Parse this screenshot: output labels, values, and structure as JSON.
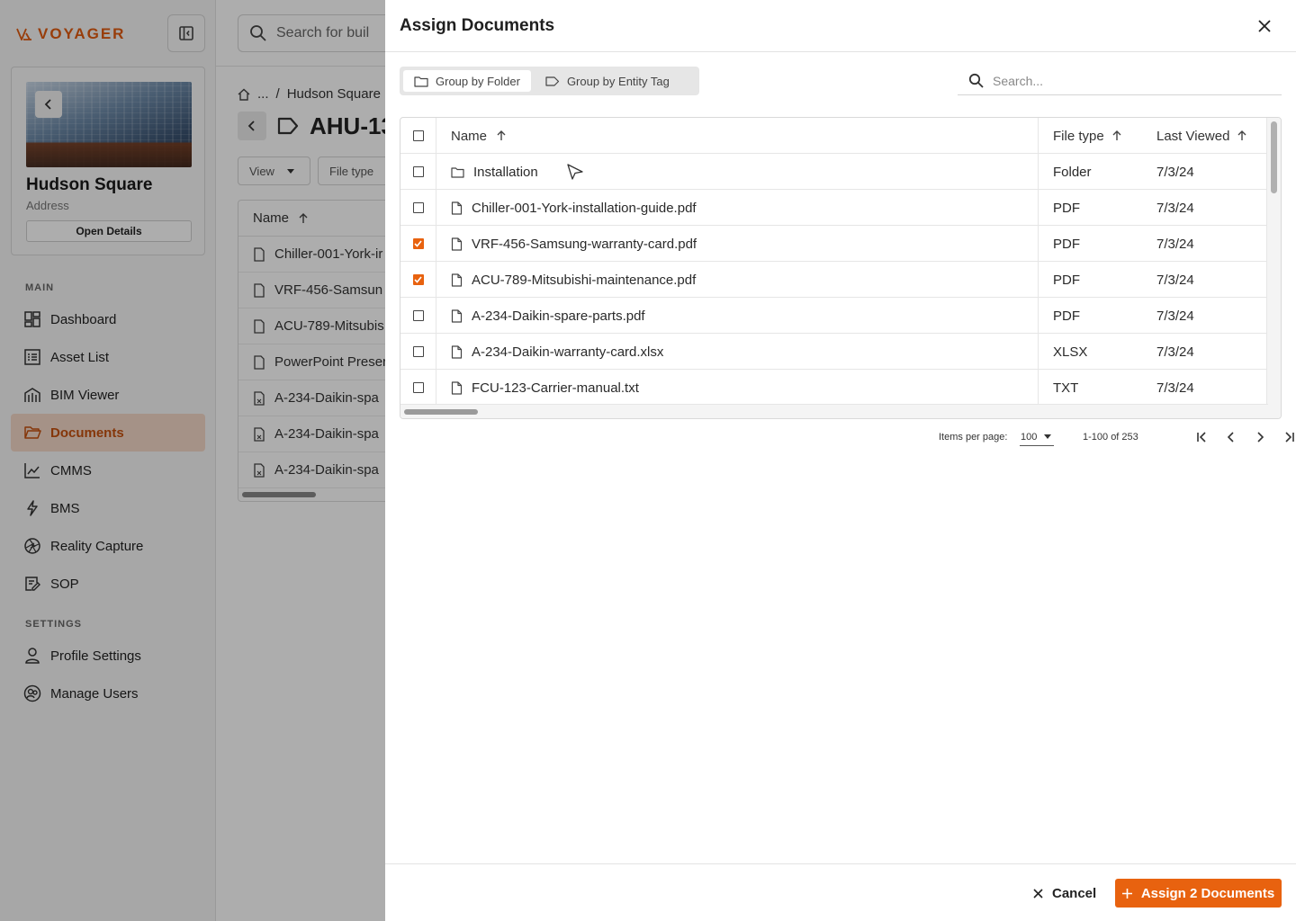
{
  "app": {
    "brand": "VOYAGER",
    "accent_color": "#e8620f",
    "building": {
      "name": "Hudson Square",
      "address": "Address",
      "open_details_label": "Open Details"
    },
    "nav": {
      "main_section": "MAIN",
      "settings_section": "SETTINGS",
      "items": [
        {
          "label": "Dashboard",
          "icon": "dashboard-icon"
        },
        {
          "label": "Asset List",
          "icon": "list-icon"
        },
        {
          "label": "BIM Viewer",
          "icon": "building-icon"
        },
        {
          "label": "Documents",
          "icon": "folder-icon",
          "active": true
        },
        {
          "label": "CMMS",
          "icon": "chart-icon"
        },
        {
          "label": "BMS",
          "icon": "bolt-icon"
        },
        {
          "label": "Reality Capture",
          "icon": "aperture-icon"
        },
        {
          "label": "SOP",
          "icon": "edit-doc-icon"
        }
      ],
      "settings_items": [
        {
          "label": "Profile Settings",
          "icon": "user-icon"
        },
        {
          "label": "Manage Users",
          "icon": "users-circle-icon"
        }
      ]
    },
    "topbar": {
      "search_placeholder": "Search for buil"
    },
    "breadcrumb": {
      "ellipsis": "...",
      "separator": "/",
      "current": "Hudson Square"
    },
    "asset_title": "AHU-13",
    "filters": {
      "view_label": "View",
      "file_type_label": "File type"
    },
    "bg_table": {
      "header": "Name",
      "rows": [
        "Chiller-001-York-ir",
        "VRF-456-Samsun",
        "ACU-789-Mitsubis",
        "PowerPoint Preser",
        "A-234-Daikin-spa",
        "A-234-Daikin-spa",
        "A-234-Daikin-spa"
      ]
    }
  },
  "dialog": {
    "title": "Assign Documents",
    "tabs": [
      {
        "label": "Group by Folder",
        "active": true
      },
      {
        "label": "Group by Entity Tag",
        "active": false
      }
    ],
    "search_placeholder": "Search...",
    "columns": {
      "name": "Name",
      "file_type": "File type",
      "last_viewed": "Last Viewed"
    },
    "rows": [
      {
        "name": "Installation",
        "type": "Folder",
        "viewed": "7/3/24",
        "checked": false,
        "kind": "folder"
      },
      {
        "name": "Chiller-001-York-installation-guide.pdf",
        "type": "PDF",
        "viewed": "7/3/24",
        "checked": false,
        "kind": "file"
      },
      {
        "name": "VRF-456-Samsung-warranty-card.pdf",
        "type": "PDF",
        "viewed": "7/3/24",
        "checked": true,
        "kind": "file"
      },
      {
        "name": "ACU-789-Mitsubishi-maintenance.pdf",
        "type": "PDF",
        "viewed": "7/3/24",
        "checked": true,
        "kind": "file"
      },
      {
        "name": "A-234-Daikin-spare-parts.pdf",
        "type": "PDF",
        "viewed": "7/3/24",
        "checked": false,
        "kind": "file"
      },
      {
        "name": "A-234-Daikin-warranty-card.xlsx",
        "type": "XLSX",
        "viewed": "7/3/24",
        "checked": false,
        "kind": "file"
      },
      {
        "name": "FCU-123-Carrier-manual.txt",
        "type": "TXT",
        "viewed": "7/3/24",
        "checked": false,
        "kind": "file"
      }
    ],
    "pagination": {
      "items_per_page_label": "Items per page:",
      "items_per_page": "100",
      "range": "1-100 of 253"
    },
    "footer": {
      "cancel_label": "Cancel",
      "assign_label": "Assign 2 Documents"
    }
  }
}
